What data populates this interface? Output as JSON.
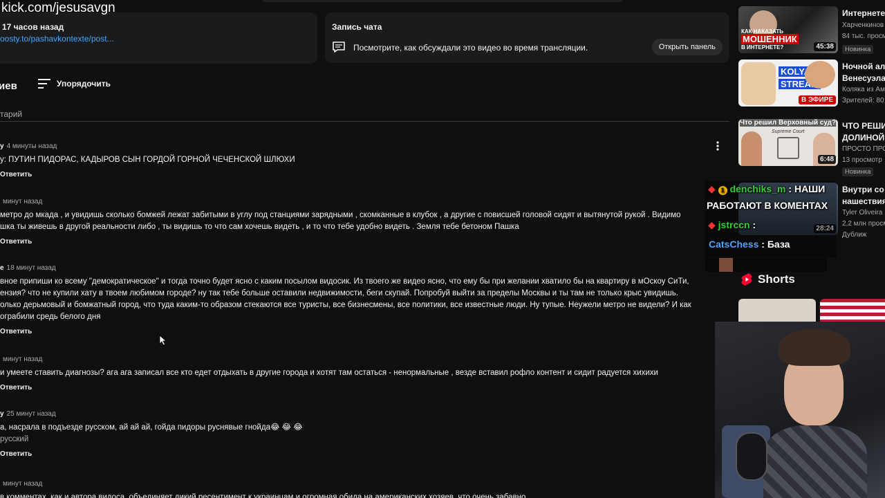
{
  "watermark": "kick.com/jesusavgn",
  "description": {
    "time": "17 часов назад",
    "link": "oosty.to/pashavkontexte/post..."
  },
  "chat_replay": {
    "title": "Запись чата",
    "text": "Посмотрите, как обсуждали это видео во время трансляции.",
    "button": "Открыть панель"
  },
  "comments_header": {
    "count_label": "иев",
    "sort_label": "Упорядочить",
    "add_comment": "тарий"
  },
  "comments": [
    {
      "author": "у",
      "time": "4 минуты назад",
      "lines": [
        "у: ПУТИН ПИДОРАС, КАДЫРОВ СЫН ГОРДОЙ ГОРНОЙ ЧЕЧЕНСКОЙ ШЛЮХИ"
      ],
      "reply": "Ответить"
    },
    {
      "author": "",
      "time": "минут назад",
      "lines": [
        "метро до мкада , и увидишь сколько бомжей лежат забитыми в углу под станциями зарядными , скомканные в клубок , а другие с повисшей головой сидят и вытянутой рукой . Видимо",
        "шка ты живешь в другой реальности либо , ты видишь то что сам хочешь видеть , и то что тебе удобно видеть . Земля тебе бетоном Пашка"
      ],
      "reply": "Ответить"
    },
    {
      "author": "е",
      "time": "18 минут назад",
      "lines": [
        "вное припиши ко всему \"демократическое\" и тогда точно будет ясно с каким посылом видосик. Из твоего же видео ясно, что ему бы при желании хватило бы на квартиру в мОскоу СиТи,",
        "ензия? что не купили хату в твоем любимом городе? ну так тебе больше оставили недвижимости, беги скупай. Попробуй выйти за пределы Москвы и ты там не только крыс увидишь.",
        "олько дерьмовый и бомжатный город, что туда каким-то образом стекаются все туристы, все бизнесмены, все политики, все известные люди. Ну тупые. Неужели метро не видели? И как",
        "ограбили средь белого дня"
      ],
      "reply": "Ответить"
    },
    {
      "author": "",
      "time": "минут назад",
      "lines": [
        "и умеете ставить диагнозы? ага ага записал все кто едет отдыхать в другие города и хотят там остаться - ненормальные , везде вставил рофло контент и сидит радуется хихихи"
      ],
      "reply": "Ответить"
    },
    {
      "author": "у",
      "time": "25 минут назад",
      "lines": [
        "а, насрала в подъезде русском, ай ай ай, гойда пидоры руснявые гнойда😂 😂 😂",
        "русский"
      ],
      "reply": "Ответить"
    },
    {
      "author": "",
      "time": "минут назад",
      "lines": [
        "в комментах, как и автора видоса, объединяет дикий ресентимент к украинцам и огромная обида на американских хозяев, что очень забавно"
      ],
      "reply": ""
    }
  ],
  "recommendations": [
    {
      "title": [
        "Интернете?"
      ],
      "channel": "Харченкинов",
      "views": "84 тыс. просм",
      "badge": "Новинка",
      "duration": "45:38",
      "thumb_text": [
        "КАК НАКАЗАТЬ",
        "МОШЕННИК",
        "В ИНТЕРНЕТЕ?"
      ]
    },
    {
      "title": [
        "Ночной алк",
        "Венесуэла"
      ],
      "channel": "Коляка из Ам",
      "views": "Зрителей: 80",
      "badge": "",
      "duration": "",
      "live": "В ЭФИРЕ",
      "thumb_text": [
        "KOLYAKA",
        "STREAM"
      ]
    },
    {
      "title": [
        "ЧТО РЕШИ",
        "ДОЛИНОЙ?"
      ],
      "channel": "ПРОСТО ПРО",
      "views": "13 просмотр",
      "badge": "Новинка",
      "duration": "6:48",
      "thumb_text": [
        "Что решил Верховный суд?",
        "Supreme Court"
      ]
    },
    {
      "title": [
        "Внутри со",
        "нашествия"
      ],
      "channel": "Tyler Oliveira",
      "views": "2,2 млн просм",
      "badge": "Дуближ",
      "duration": "28:24",
      "thumb_text": []
    }
  ],
  "chat_overlay": [
    {
      "user": "denchiks_m",
      "text": "НАШИ",
      "color": "#35d035"
    },
    {
      "user": "",
      "text": "РАБОТАЮТ В КОМЕНТАХ",
      "color": "#ffffff"
    },
    {
      "user": "jstrccn",
      "text": "",
      "color": "#35d035"
    },
    {
      "user": "CatsChess",
      "text": "База",
      "color": "#4fa3ff"
    }
  ],
  "shorts_label": "Shorts",
  "colors": {
    "background": "#0f0f0f",
    "card": "#1b1b1b",
    "link": "#3ea6ff",
    "meta": "#aaaaaa",
    "live": "#cc0000"
  }
}
